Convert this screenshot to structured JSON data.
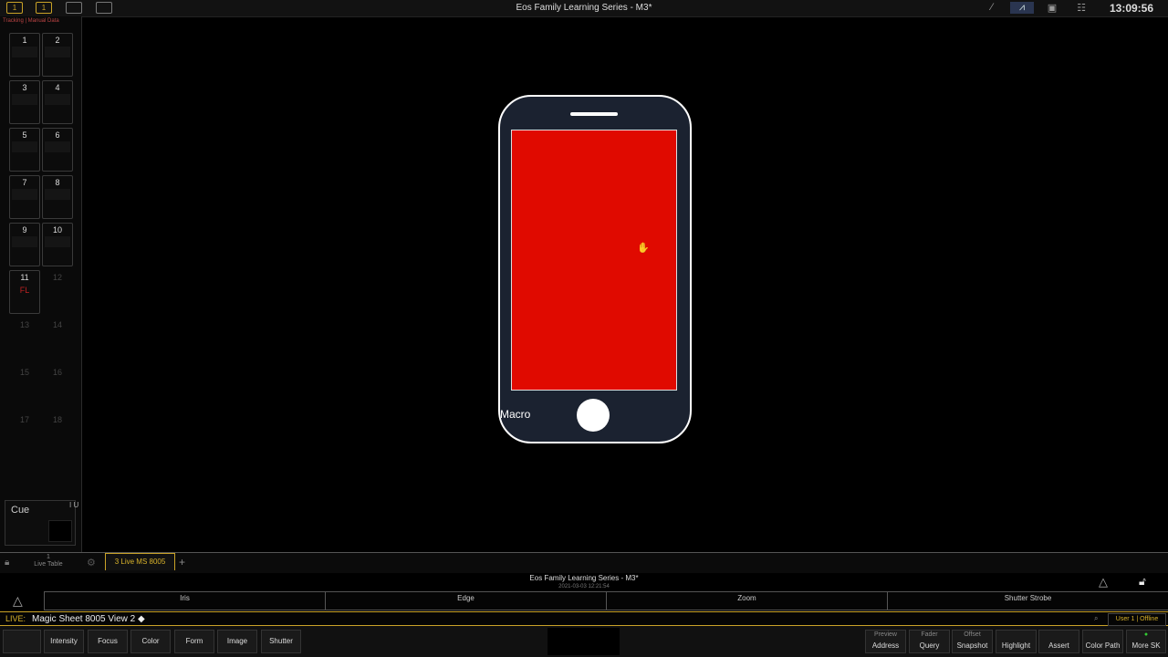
{
  "topbar": {
    "title": "Eos Family Learning Series - M3*",
    "clock": "13:09:56",
    "buttons": [
      "1",
      "1"
    ]
  },
  "left_panel": {
    "mode_label": "Tracking | Manual Data",
    "buttons": [
      {
        "label": "1"
      },
      {
        "label": "2"
      },
      {
        "label": "3"
      },
      {
        "label": "4"
      },
      {
        "label": "5"
      },
      {
        "label": "6"
      },
      {
        "label": "7"
      },
      {
        "label": "8"
      },
      {
        "label": "9"
      },
      {
        "label": "10"
      },
      {
        "label": "11",
        "flag": "FL"
      },
      {
        "label": "12"
      },
      {
        "label": "13"
      },
      {
        "label": "14"
      },
      {
        "label": "15"
      },
      {
        "label": "16"
      },
      {
        "label": "17"
      },
      {
        "label": "18"
      }
    ],
    "cue_label": "Cue",
    "cue_side": "I U"
  },
  "phone": {
    "macro_label": "Macro",
    "screen_color": "#e00a00"
  },
  "tabs": {
    "live_table_index": "1",
    "live_table_label": "Live Table",
    "active_tab": "3 Live MS 8005"
  },
  "status": {
    "show_title": "Eos Family Learning Series - M3*",
    "date": "2021-03-03 12:21:54"
  },
  "categories": [
    "Iris",
    "Edge",
    "Zoom",
    "Shutter Strobe"
  ],
  "command_line": {
    "prefix": "LIVE:",
    "text": "Magic Sheet 8005 View 2 ◆",
    "user": "User 1 | Offline"
  },
  "softkeys_left": [
    "Intensity",
    "Focus",
    "Color",
    "Form",
    "Image",
    "Shutter"
  ],
  "softkeys_right": [
    {
      "sub": "Preview",
      "label": "Address"
    },
    {
      "sub": "Fader",
      "label": "Query"
    },
    {
      "sub": "Offset",
      "label": "Snapshot"
    },
    {
      "sub": "",
      "label": "Highlight"
    },
    {
      "sub": "",
      "label": "Assert"
    },
    {
      "sub": "",
      "label": "Color Path"
    },
    {
      "sub": "",
      "label": "More SK"
    }
  ],
  "colors": {
    "accent": "#c9a227",
    "screen_red": "#e00a00",
    "phone_body": "#1b2230"
  }
}
